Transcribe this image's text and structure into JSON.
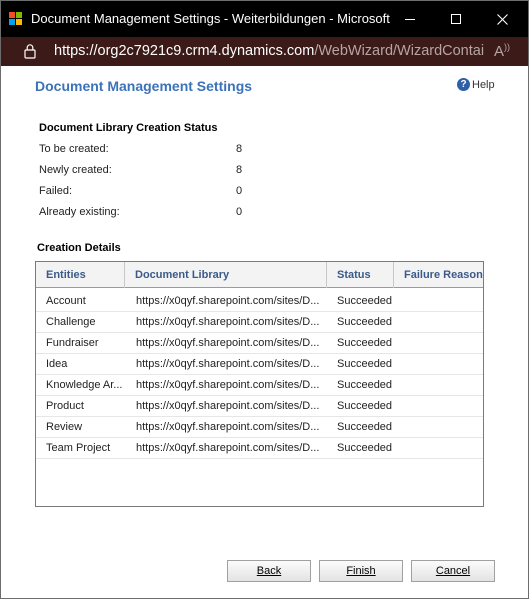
{
  "window": {
    "title": "Document Management Settings - Weiterbildungen - Microsoft E...",
    "url_host": "https://org2c7921c9.crm4.dynamics.com",
    "url_rest": "/WebWizard/WizardContai..."
  },
  "page": {
    "title": "Document Management Settings",
    "help_label": "Help"
  },
  "status": {
    "heading": "Document Library Creation Status",
    "rows": [
      {
        "label": "To be created:",
        "value": "8"
      },
      {
        "label": "Newly created:",
        "value": "8"
      },
      {
        "label": "Failed:",
        "value": "0"
      },
      {
        "label": "Already existing:",
        "value": "0"
      }
    ]
  },
  "details": {
    "heading": "Creation Details",
    "columns": [
      "Entities",
      "Document Library",
      "Status",
      "Failure Reason"
    ],
    "rows": [
      {
        "entity": "Account",
        "library": "https://x0qyf.sharepoint.com/sites/D...",
        "status": "Succeeded",
        "reason": ""
      },
      {
        "entity": "Challenge",
        "library": "https://x0qyf.sharepoint.com/sites/D...",
        "status": "Succeeded",
        "reason": ""
      },
      {
        "entity": "Fundraiser",
        "library": "https://x0qyf.sharepoint.com/sites/D...",
        "status": "Succeeded",
        "reason": ""
      },
      {
        "entity": "Idea",
        "library": "https://x0qyf.sharepoint.com/sites/D...",
        "status": "Succeeded",
        "reason": ""
      },
      {
        "entity": "Knowledge Ar...",
        "library": "https://x0qyf.sharepoint.com/sites/D...",
        "status": "Succeeded",
        "reason": ""
      },
      {
        "entity": "Product",
        "library": "https://x0qyf.sharepoint.com/sites/D...",
        "status": "Succeeded",
        "reason": ""
      },
      {
        "entity": "Review",
        "library": "https://x0qyf.sharepoint.com/sites/D...",
        "status": "Succeeded",
        "reason": ""
      },
      {
        "entity": "Team Project",
        "library": "https://x0qyf.sharepoint.com/sites/D...",
        "status": "Succeeded",
        "reason": ""
      }
    ]
  },
  "buttons": {
    "back": "Back",
    "finish": "Finish",
    "cancel": "Cancel"
  },
  "icons": {
    "app": "microsoft-logo-icon",
    "lock": "lock-icon",
    "read_aloud": "read-aloud-icon",
    "help": "help-icon"
  },
  "colors": {
    "title_accent": "#3b73b9",
    "column_header": "#3b5a89",
    "address_bar": "#3b1a18"
  }
}
